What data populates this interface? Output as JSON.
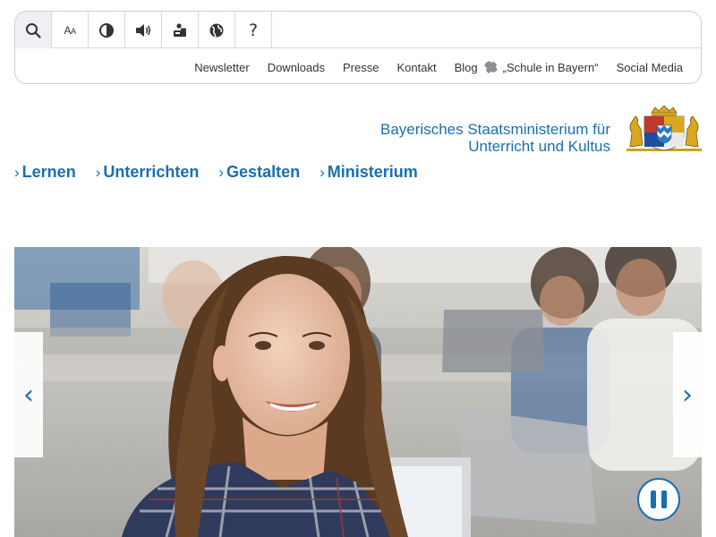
{
  "toolbar": {
    "tools": [
      {
        "icon": "search-icon"
      },
      {
        "icon": "font-size-icon",
        "label_big": "A",
        "label_small": "A"
      },
      {
        "icon": "contrast-icon"
      },
      {
        "icon": "speaker-icon"
      },
      {
        "icon": "sign-language-icon"
      },
      {
        "icon": "globe-icon"
      },
      {
        "icon": "help-icon",
        "label": "?"
      }
    ]
  },
  "utility_links": {
    "newsletter": "Newsletter",
    "downloads": "Downloads",
    "presse": "Presse",
    "kontakt": "Kontakt",
    "blog": "Blog",
    "blog_title": "„Schule in Bayern“",
    "social": "Social Media"
  },
  "ministry": {
    "line1": "Bayerisches Staatsministerium für",
    "line2": "Unterricht und Kultus"
  },
  "mainnav": [
    {
      "chevron": "›",
      "label": "Lernen"
    },
    {
      "chevron": "›",
      "label": "Unterrichten"
    },
    {
      "chevron": "›",
      "label": "Gestalten"
    },
    {
      "chevron": "›",
      "label": "Ministerium"
    }
  ],
  "slider": {
    "prev_glyph": "‹",
    "next_glyph": "›",
    "state": "playing"
  },
  "colors": {
    "brand_blue": "#1a6fae",
    "border": "#c9ced6"
  }
}
